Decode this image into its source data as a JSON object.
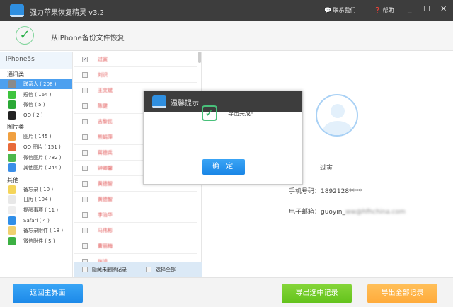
{
  "titlebar": {
    "title": "强力苹果恢复精灵 v3.2",
    "contact": "联系我们",
    "help": "帮助",
    "minimize": "_",
    "maximize": "☐",
    "close": "✕"
  },
  "header": {
    "title": "从iPhone备份文件恢复"
  },
  "sidebar": {
    "device": "iPhone5s",
    "groups": [
      {
        "label": "通讯类",
        "items": [
          {
            "label": "联系人 ( 208 )",
            "icon": "contacts-icon",
            "color": "#8a8a8a"
          },
          {
            "label": "短信 ( 164 )",
            "icon": "sms-icon",
            "color": "#3ec43e"
          },
          {
            "label": "微信 ( 5 )",
            "icon": "wechat-icon",
            "color": "#2aa836"
          },
          {
            "label": "QQ ( 2 )",
            "icon": "qq-icon",
            "color": "#222222"
          }
        ]
      },
      {
        "label": "图片类",
        "items": [
          {
            "label": "图片 ( 145 )",
            "icon": "photos-icon",
            "color": "#f0a040"
          },
          {
            "label": "QQ 图片 ( 151 )",
            "icon": "qq-photos-icon",
            "color": "#e86a3a"
          },
          {
            "label": "微信图片 ( 782 )",
            "icon": "wechat-photos-icon",
            "color": "#4cb84c"
          },
          {
            "label": "其他图片 ( 244 )",
            "icon": "other-photos-icon",
            "color": "#3a8ee8"
          }
        ]
      },
      {
        "label": "其他",
        "items": [
          {
            "label": "备忘录 ( 10 )",
            "icon": "notes-icon",
            "color": "#f5d55a"
          },
          {
            "label": "日历 ( 104 )",
            "icon": "calendar-icon",
            "color": "#e8e8e8"
          },
          {
            "label": "提醒事项 ( 11 )",
            "icon": "reminders-icon",
            "color": "#eeeeee"
          },
          {
            "label": "Safari ( 4 )",
            "icon": "safari-icon",
            "color": "#2f8ee8"
          },
          {
            "label": "备忘录附件 ( 18 )",
            "icon": "notes-attachment-icon",
            "color": "#f0d070"
          },
          {
            "label": "微信附件 ( 5 )",
            "icon": "wechat-attachment-icon",
            "color": "#3cb043"
          }
        ]
      }
    ]
  },
  "list": {
    "rows": [
      {
        "name": "过寅",
        "checked": true
      },
      {
        "name": "刘识"
      },
      {
        "name": "王文斌"
      },
      {
        "name": "陈健"
      },
      {
        "name": "吉黎民"
      },
      {
        "name": "熊娟萍"
      },
      {
        "name": "蒋德兵"
      },
      {
        "name": "钟卿馨"
      },
      {
        "name": "黄德智"
      },
      {
        "name": "黄德智"
      },
      {
        "name": "李治华"
      },
      {
        "name": "马伟彬"
      },
      {
        "name": "曹丽梅"
      },
      {
        "name": "张鸿"
      }
    ],
    "hide_undeleted": "隐藏未删除记录",
    "select_all": "选择全部"
  },
  "detail": {
    "name": "过寅",
    "phone": "手机号码：1892128****",
    "email_label": "电子邮箱：guoyin_",
    "email_blurred": "ww@hfhchina.com"
  },
  "dialog": {
    "title": "温馨提示",
    "message": "导出完成！",
    "ok": "确 定"
  },
  "bottom": {
    "back": "返回主界面",
    "export_selected": "导出选中记录",
    "export_all": "导出全部记录"
  }
}
